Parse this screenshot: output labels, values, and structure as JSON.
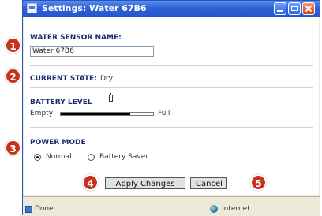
{
  "window": {
    "title": "Settings: Water 67B6"
  },
  "sensor_name": {
    "label": "WATER SENSOR NAME:",
    "value": "Water 67B6"
  },
  "current_state": {
    "label": "CURRENT STATE:",
    "value": "Dry"
  },
  "battery": {
    "label": "BATTERY LEVEL",
    "empty_label": "Empty",
    "full_label": "Full",
    "level_percent": 75
  },
  "power_mode": {
    "label": "POWER MODE",
    "options": [
      "Normal",
      "Battery Saver"
    ],
    "selected": "Normal"
  },
  "buttons": {
    "apply": "Apply Changes",
    "cancel": "Cancel"
  },
  "statusbar": {
    "left": "Done",
    "zone": "Internet"
  },
  "callouts": [
    "1",
    "2",
    "3",
    "4",
    "5"
  ],
  "colors": {
    "callout": "#c8321a",
    "titlebar": "#2e63d6",
    "label": "#1a2b6b"
  }
}
